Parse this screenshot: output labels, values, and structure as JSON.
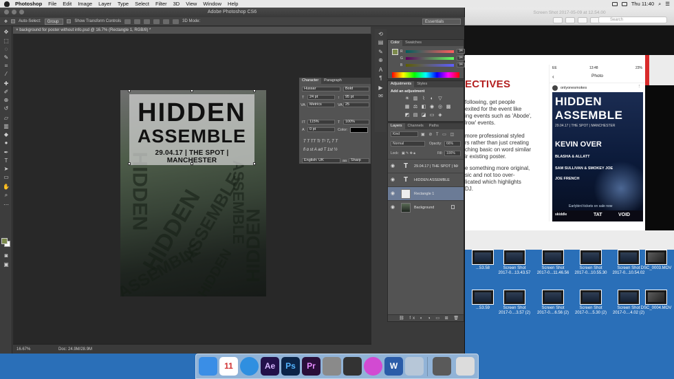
{
  "menubar": {
    "app": "Photoshop",
    "items": [
      "File",
      "Edit",
      "Image",
      "Layer",
      "Type",
      "Select",
      "Filter",
      "3D",
      "View",
      "Window",
      "Help"
    ],
    "clock": "Thu 11:40"
  },
  "photoshop": {
    "window_title": "Adobe Photoshop CS6",
    "options": {
      "auto_select_label": "Auto-Select:",
      "auto_select_value": "Group",
      "transform_label": "Show Transform Controls",
      "mode_3d": "3D Mode:",
      "workspace": "Essentials"
    },
    "document_tab": "background for poster without info.psd @ 16.7% (Rectangle 1, RGB/8) *",
    "status": {
      "zoom": "16.67%",
      "doc_size": "Doc: 24.9M/28.9M"
    },
    "poster": {
      "title1": "HIDDEN",
      "title2": "ASSEMBLE",
      "info": "29.04.17 | THE SPOT | MANCHESTER"
    },
    "character_panel": {
      "tabs": [
        "Character",
        "Paragraph"
      ],
      "font_family": "Hussar",
      "font_style": "Bold",
      "font_size": "24 pt",
      "leading": "95 pt",
      "kerning": "Metrics",
      "tracking": "25",
      "vertical_scale": "115%",
      "horizontal_scale": "100%",
      "baseline_shift": "0 pt",
      "color_label": "Color:",
      "type_style_buttons": "T T TT Tr T¹ T₁ T T",
      "language": "English: UK",
      "antialias": "Sharp"
    },
    "color_panel": {
      "tabs": [
        "Color",
        "Swatches"
      ],
      "channels": [
        {
          "label": "R",
          "value": "94"
        },
        {
          "label": "G",
          "value": "94"
        },
        {
          "label": "B",
          "value": "94"
        }
      ],
      "fg_color": "#7c8a4c"
    },
    "adjustments_panel": {
      "tabs": [
        "Adjustments",
        "Styles"
      ],
      "title": "Add an adjustment"
    },
    "layers_panel": {
      "tabs": [
        "Layers",
        "Channels",
        "Paths"
      ],
      "filter_kind": "Kind",
      "blend_mode": "Normal",
      "opacity_label": "Opacity:",
      "opacity": "66%",
      "lock_label": "Lock:",
      "fill_label": "Fill:",
      "fill": "100%",
      "layers": [
        {
          "name": "29.04.17 | THE SPOT | MAN...",
          "kind": "text",
          "selected": false
        },
        {
          "name": "HIDDEN  ASSEMBLE",
          "kind": "text",
          "selected": false
        },
        {
          "name": "Rectangle 1",
          "kind": "shape",
          "selected": true
        },
        {
          "name": "Background",
          "kind": "image",
          "selected": false
        }
      ]
    }
  },
  "preview": {
    "title": "Screen Shot 2017-05-09 at 12.54.00",
    "search_placeholder": "Search",
    "heading": "ECTIVES",
    "paragraphs": [
      "following, get people\nexited for the event like\ning events such as 'Abode',\nlrow' events.",
      "more professional styled\nrs rather than just creating\nching basic on word similar\nir existing poster.",
      "e something more original,\nsic and not too over-\nlicated which highlights\nDJ."
    ],
    "phone": {
      "carrier": "EE",
      "time": "13:48",
      "battery": "23%",
      "nav_title": "Photo",
      "username": "onlyonesmokes",
      "poster_title1": "HIDDEN",
      "poster_title2": "ASSEMBLE",
      "poster_info": "29.04.17 | THE SPOT | MANCHESTER",
      "headliner": "KEVIN OVER",
      "acts": [
        "BLASHA & ALLATT",
        "SAM SULLIVAN & SMOKEY JOE",
        "JOE FRENCH"
      ],
      "early_bird": "Earlybird tickets on sale now",
      "footer_logo1": "TAT",
      "footer_logo2": "VOID",
      "footer_brand": "skiddle"
    }
  },
  "desktop": {
    "files_row1": [
      {
        "label": "...53.58",
        "kind": "image"
      },
      {
        "label": "Screen Shot\n2017-0...13.43.57",
        "kind": "image"
      },
      {
        "label": "Screen Shot\n2017-0...11.46.56",
        "kind": "image"
      },
      {
        "label": "Screen Shot\n2017-0...10.55.30",
        "kind": "image"
      },
      {
        "label": "Screen Shot\n2017-0...10.54.02",
        "kind": "image"
      },
      {
        "label": "DSC_0003.MOV",
        "kind": "movie"
      }
    ],
    "files_row2": [
      {
        "label": "...53.59",
        "kind": "image"
      },
      {
        "label": "Screen Shot\n2017-0....3.57 (2)",
        "kind": "image"
      },
      {
        "label": "Screen Shot\n2017-0....6.56 (2)",
        "kind": "image"
      },
      {
        "label": "Screen Shot\n2017-0....5.30 (2)",
        "kind": "image"
      },
      {
        "label": "Screen Shot\n2017-0....4.02 (2)",
        "kind": "image"
      },
      {
        "label": "DSC_0004.MOV",
        "kind": "movie"
      }
    ]
  },
  "dock": {
    "items": [
      {
        "name": "finder",
        "label": "",
        "color": "#3a8ee6"
      },
      {
        "name": "calendar",
        "label": "11",
        "color": "#ffffff"
      },
      {
        "name": "safari",
        "label": "",
        "color": "#2f8fe0"
      },
      {
        "name": "after-effects",
        "label": "Ae",
        "color": "#22114a"
      },
      {
        "name": "photoshop",
        "label": "Ps",
        "color": "#0b2448"
      },
      {
        "name": "premiere",
        "label": "Pr",
        "color": "#2a0f3a"
      },
      {
        "name": "automator",
        "label": "",
        "color": "#8a8a8a"
      },
      {
        "name": "final-cut",
        "label": "",
        "color": "#333333"
      },
      {
        "name": "itunes",
        "label": "",
        "color": "#d24ad2"
      },
      {
        "name": "word",
        "label": "W",
        "color": "#2b5ca8"
      },
      {
        "name": "preview",
        "label": "",
        "color": "#b7c7d8"
      },
      {
        "name": "screen",
        "label": "",
        "color": "#5a5a5a"
      },
      {
        "name": "trash",
        "label": "",
        "color": "#dcdcdc"
      }
    ]
  }
}
